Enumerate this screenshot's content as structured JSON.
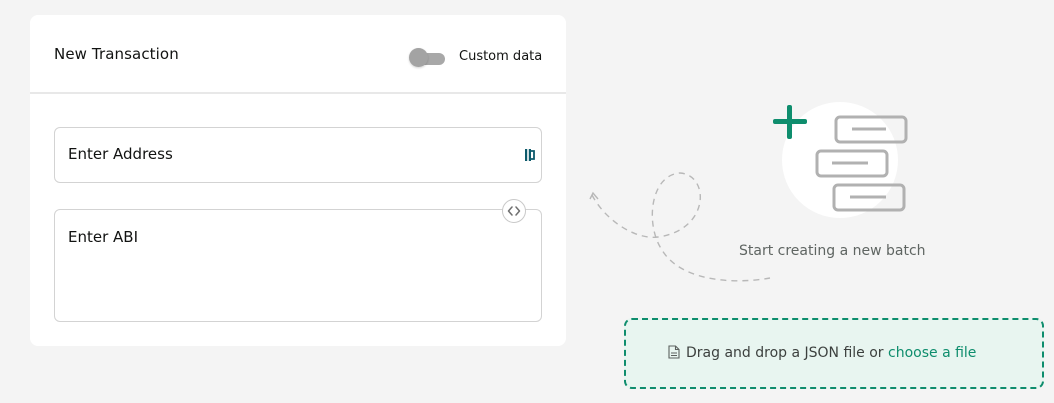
{
  "transaction_card": {
    "title": "New Transaction",
    "custom_data_label": "Custom data",
    "address_placeholder": "Enter Address",
    "abi_placeholder": "Enter ABI"
  },
  "empty_state": {
    "title": "Start creating a new batch"
  },
  "dropzone": {
    "text": "Drag and drop a JSON file or",
    "link": "choose a file"
  },
  "colors": {
    "accent": "#0e8d6d",
    "dropzone_bg": "#e8f5f0",
    "page_bg": "#f4f4f4"
  },
  "icons": [
    "toggle",
    "address-book-icon",
    "code-icon",
    "plus-icon",
    "batch-list-icon",
    "file-icon"
  ]
}
